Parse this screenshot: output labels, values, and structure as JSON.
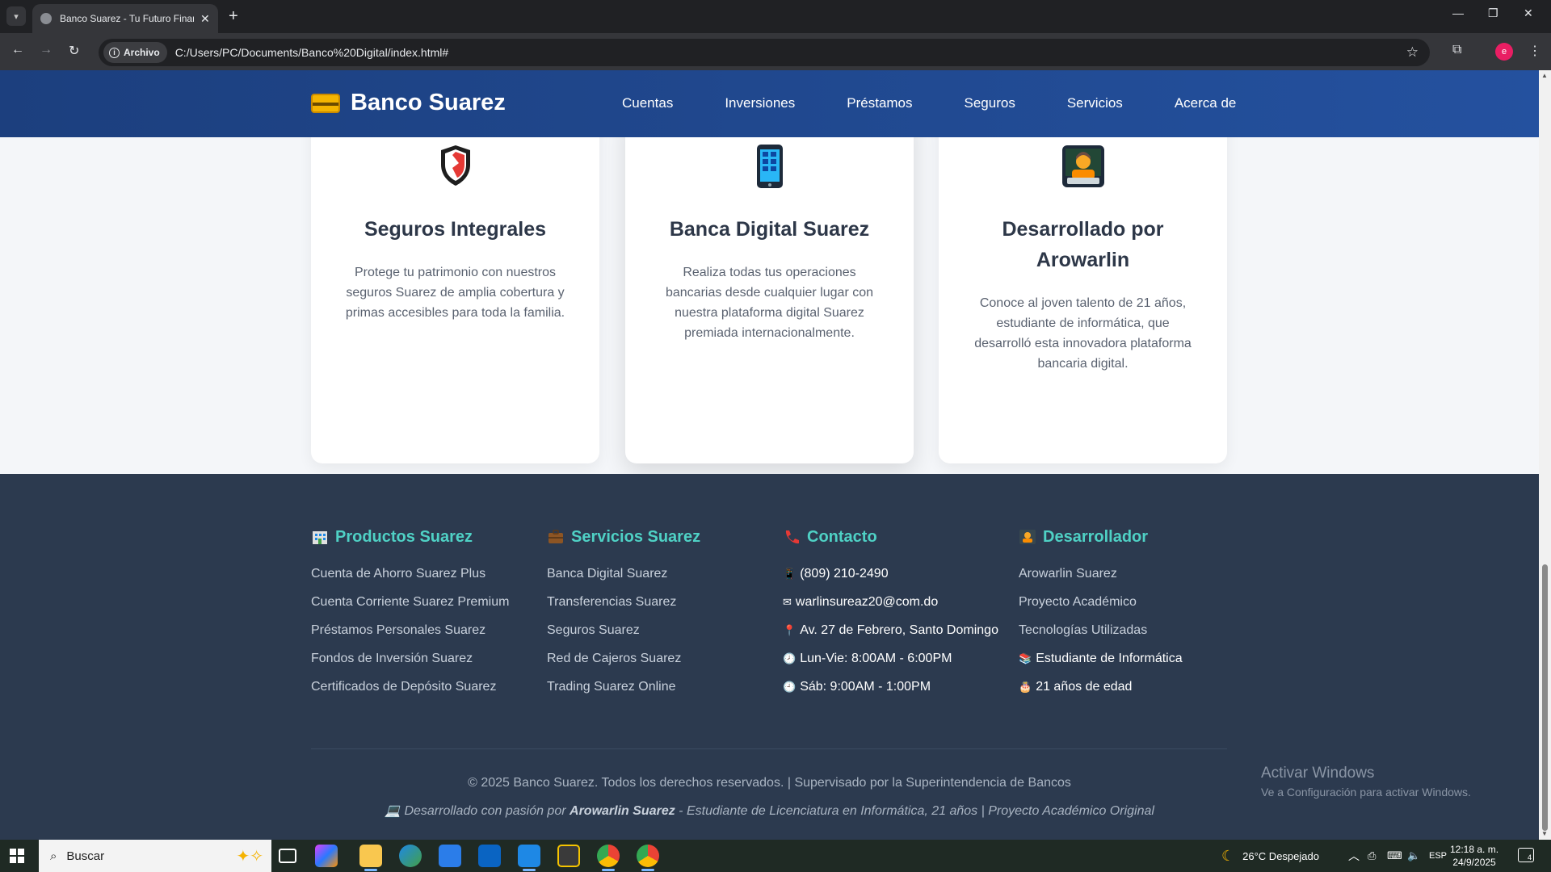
{
  "browser": {
    "tab_title": "Banco Suarez - Tu Futuro Financiero",
    "site_chip": "Archivo",
    "url": "C:/Users/PC/Documents/Banco%20Digital/index.html#",
    "profile_initial": "e"
  },
  "header": {
    "logo_text": "Banco Suarez",
    "nav": [
      "Cuentas",
      "Inversiones",
      "Préstamos",
      "Seguros",
      "Servicios",
      "Acerca de"
    ]
  },
  "cards": [
    {
      "icon": "shield-icon",
      "title": "Seguros Integrales",
      "description": "Protege tu patrimonio con nuestros seguros Suarez de amplia cobertura y primas accesibles para toda la familia."
    },
    {
      "icon": "mobile-phone-icon",
      "title": "Banca Digital Suarez",
      "description": "Realiza todas tus operaciones bancarias desde cualquier lugar con nuestra plataforma digital Suarez premiada internacionalmente."
    },
    {
      "icon": "technologist-icon",
      "title": "Desarrollado por Arowarlin",
      "description": "Conoce al joven talento de 21 años, estudiante de informática, que desarrolló esta innovadora plataforma bancaria digital."
    }
  ],
  "footer": {
    "productos": {
      "title": "Productos Suarez",
      "items": [
        "Cuenta de Ahorro Suarez Plus",
        "Cuenta Corriente Suarez Premium",
        "Préstamos Personales Suarez",
        "Fondos de Inversión Suarez",
        "Certificados de Depósito Suarez"
      ]
    },
    "servicios": {
      "title": "Servicios Suarez",
      "items": [
        "Banca Digital Suarez",
        "Transferencias Suarez",
        "Seguros Suarez",
        "Red de Cajeros Suarez",
        "Trading Suarez Online"
      ]
    },
    "contacto": {
      "title": "Contacto",
      "phone": "(809) 210-2490",
      "email": "warlinsureaz20@com.do",
      "address": "Av. 27 de Febrero, Santo Domingo",
      "hours_week": "Lun-Vie: 8:00AM - 6:00PM",
      "hours_sat": "Sáb: 9:00AM - 1:00PM"
    },
    "desarrollador": {
      "title": "Desarrollador",
      "items": [
        "Arowarlin Suarez",
        "Proyecto Académico",
        "Tecnologías Utilizadas"
      ],
      "student": "Estudiante de Informática",
      "age": "21 años de edad"
    },
    "copyright": "© 2025 Banco Suarez. Todos los derechos reservados. | Supervisado por la Superintendencia de Bancos",
    "dev_prefix": "Desarrollado con pasión por",
    "dev_name": "Arowarlin Suarez",
    "dev_suffix": "- Estudiante de Licenciatura en Informática, 21 años | Proyecto Académico Original"
  },
  "watermark": {
    "line1": "Activar Windows",
    "line2": "Ve a Configuración para activar Windows."
  },
  "taskbar": {
    "search_placeholder": "Buscar",
    "weather": "26°C  Despejado",
    "lang": "ESP",
    "time": "12:18 a. m.",
    "date": "24/9/2025",
    "notifications": "4"
  },
  "colors": {
    "header_bg": "#24519f",
    "footer_bg": "#2c3a4f",
    "footer_heading": "#4fd1c5"
  }
}
